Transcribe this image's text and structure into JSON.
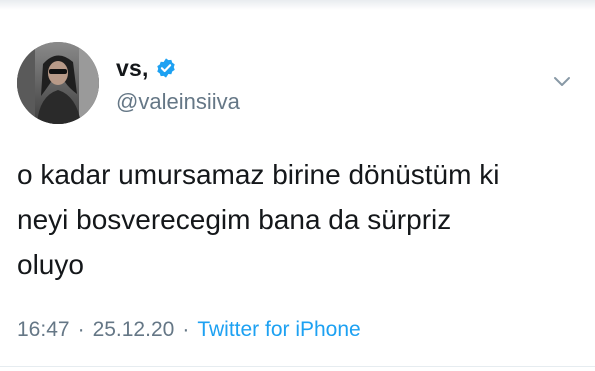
{
  "tweet": {
    "author": {
      "display_name": "vs,",
      "handle": "@valeinsiiva",
      "verified": true,
      "avatar_icon": "profile-photo"
    },
    "text": "o kadar umursamaz birine dönüstüm ki\nneyi bosverecegim bana da sürpriz\noluyo",
    "time": "16:47",
    "date": "25.12.20",
    "separator": "·",
    "source": "Twitter for iPhone"
  },
  "colors": {
    "text_primary": "#14171a",
    "text_secondary": "#657786",
    "accent": "#1da1f2"
  },
  "icons": {
    "verified": "verified-badge-icon",
    "more": "chevron-down-icon"
  }
}
